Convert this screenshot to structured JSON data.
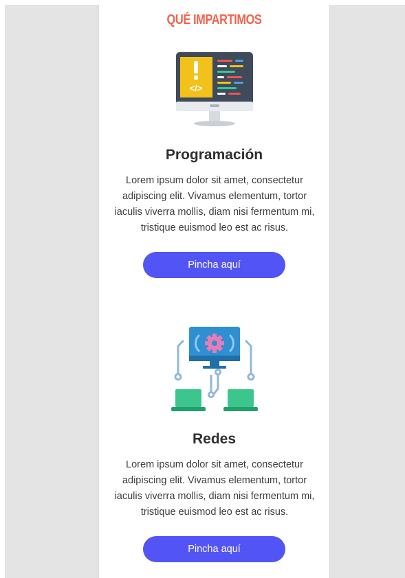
{
  "header": {
    "title": "QUÉ IMPARTIMOS"
  },
  "sections": [
    {
      "icon": "code-monitor-icon",
      "title": "Programación",
      "description": "Lorem ipsum dolor sit amet, consectetur adipiscing elit. Vivamus elementum, tortor iaculis viverra mollis, diam nisi fermentum mi, tristique euismod leo est ac risus.",
      "button_label": "Pincha aquí"
    },
    {
      "icon": "network-computers-icon",
      "title": "Redes",
      "description": "Lorem ipsum dolor sit amet, consectetur adipiscing elit. Vivamus elementum, tortor iaculis viverra mollis, diam nisi fermentum mi, tristique euismod leo est ac risus.",
      "button_label": "Pincha aquí"
    }
  ],
  "colors": {
    "accent": "#f0644e",
    "button": "#5354f5",
    "background": "#e4e4e4"
  }
}
